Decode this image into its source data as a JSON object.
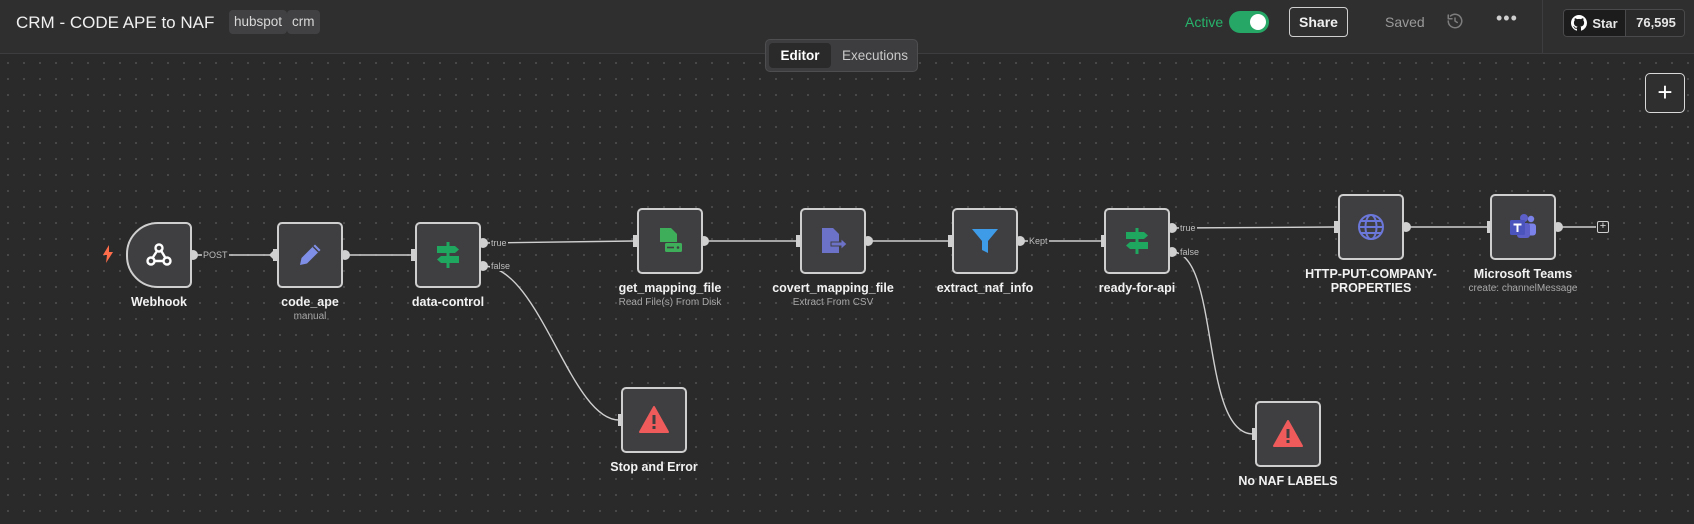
{
  "header": {
    "title": "CRM - CODE APE to NAF",
    "tags": [
      "hubspot",
      "crm"
    ],
    "active_label": "Active",
    "active": true,
    "share_label": "Share",
    "saved_label": "Saved",
    "github": {
      "star_label": "Star",
      "star_count": "76,595"
    }
  },
  "tabs": {
    "editor": "Editor",
    "executions": "Executions",
    "selected": "Editor"
  },
  "canvas": {
    "add_button": "+"
  },
  "nodes": [
    {
      "id": "webhook",
      "name": "Webhook",
      "subtitle": "",
      "icon": "webhook-icon"
    },
    {
      "id": "code_ape",
      "name": "code_ape",
      "subtitle": "manual",
      "icon": "pencil-icon"
    },
    {
      "id": "data_control",
      "name": "data-control",
      "subtitle": "",
      "icon": "signpost-icon"
    },
    {
      "id": "get_mapping_file",
      "name": "get_mapping_file",
      "subtitle": "Read File(s) From Disk",
      "icon": "file-drive-icon"
    },
    {
      "id": "covert_mapping_file",
      "name": "covert_mapping_file",
      "subtitle": "Extract From CSV",
      "icon": "file-export-icon"
    },
    {
      "id": "extract_naf_info",
      "name": "extract_naf_info",
      "subtitle": "",
      "icon": "filter-icon"
    },
    {
      "id": "ready_for_api",
      "name": "ready-for-api",
      "subtitle": "",
      "icon": "signpost-icon"
    },
    {
      "id": "http_put",
      "name": "HTTP-PUT-COMPANY-PROPERTIES",
      "subtitle": "",
      "icon": "globe-icon"
    },
    {
      "id": "ms_teams",
      "name": "Microsoft Teams",
      "subtitle": "create: channelMessage",
      "icon": "teams-icon"
    },
    {
      "id": "stop_error",
      "name": "Stop and Error",
      "subtitle": "",
      "icon": "warning-icon"
    },
    {
      "id": "no_naf",
      "name": "No NAF LABELS",
      "subtitle": "",
      "icon": "warning-icon"
    }
  ],
  "edge_labels": {
    "post": "POST",
    "dc_true": "true",
    "dc_false": "false",
    "kept": "Kept",
    "ra_true": "true",
    "ra_false": "false"
  },
  "colors": {
    "active_green": "#27b36a",
    "pencil": "#7f8fe8",
    "signpost": "#1fa65f",
    "file_drive": "#3fae5a",
    "file_export": "#6d72c9",
    "filter": "#3e9be8",
    "globe": "#6b77d9",
    "teams": "#5b5fc7",
    "warning": "#ef5b5b",
    "trigger_bolt": "#ff6d4a"
  }
}
